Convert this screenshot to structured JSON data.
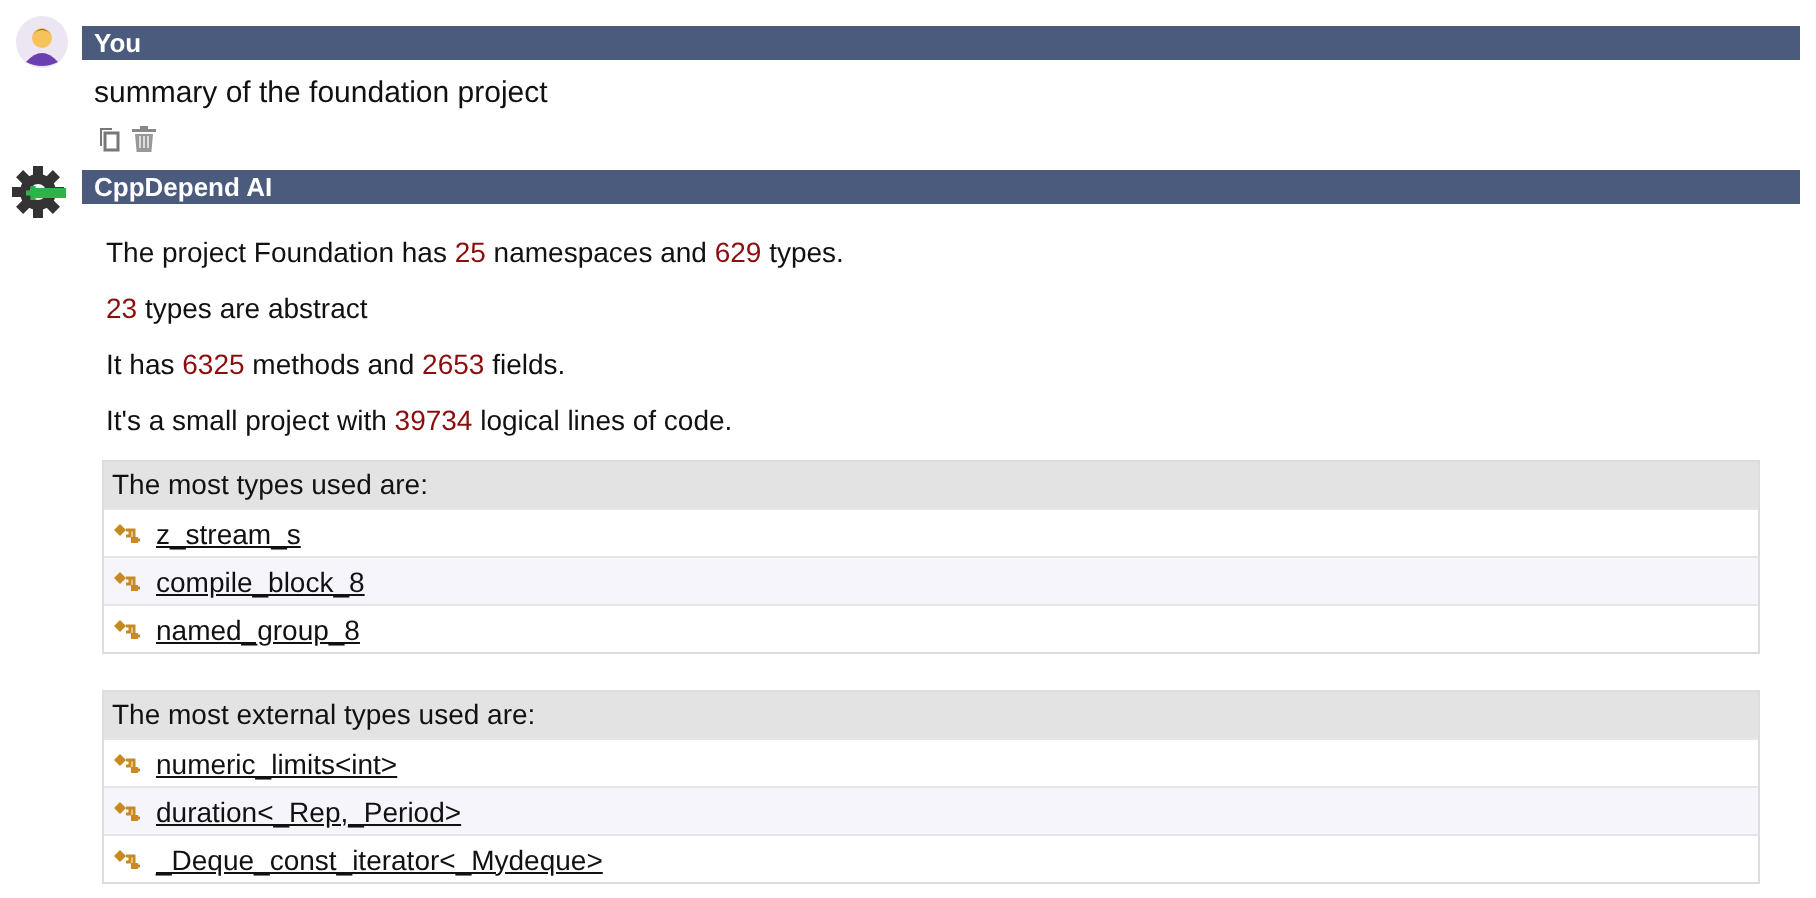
{
  "messages": [
    {
      "author": "You",
      "kind": "user",
      "text": "summary of the foundation project"
    },
    {
      "author": "CppDepend AI",
      "kind": "ai",
      "lines": [
        [
          {
            "text": "The project Foundation has ",
            "kind": "text"
          },
          {
            "text": "25",
            "kind": "number"
          },
          {
            "text": " namespaces and ",
            "kind": "text"
          },
          {
            "text": "629",
            "kind": "number"
          },
          {
            "text": " types.",
            "kind": "text"
          }
        ],
        [
          {
            "text": "23",
            "kind": "number"
          },
          {
            "text": " types are abstract",
            "kind": "text"
          }
        ],
        [
          {
            "text": "It has ",
            "kind": "text"
          },
          {
            "text": "6325",
            "kind": "number"
          },
          {
            "text": " methods and ",
            "kind": "text"
          },
          {
            "text": "2653",
            "kind": "number"
          },
          {
            "text": " fields.",
            "kind": "text"
          }
        ],
        [
          {
            "text": "It's a small project  with ",
            "kind": "text"
          },
          {
            "text": "39734",
            "kind": "number"
          },
          {
            "text": "  logical lines of code.",
            "kind": "text"
          }
        ]
      ],
      "tables": [
        {
          "header": "The most types used are:",
          "rows": [
            "z_stream_s",
            "compile_block_8",
            "named_group_8"
          ]
        },
        {
          "header": "The most external types used are:",
          "rows": [
            "numeric_limits<int>",
            "duration<_Rep,_Period>",
            "_Deque_const_iterator<_Mydeque>"
          ]
        }
      ]
    }
  ]
}
